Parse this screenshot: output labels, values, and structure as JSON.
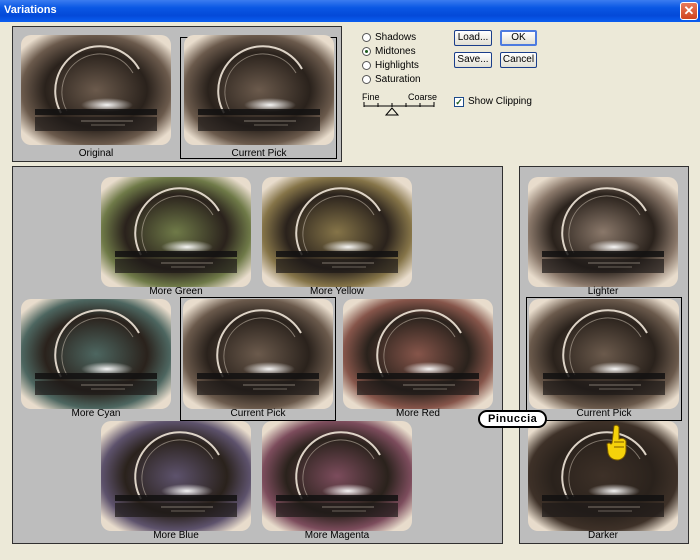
{
  "window": {
    "title": "Variations",
    "close_label": "✕"
  },
  "modes": [
    {
      "label": "Shadows",
      "selected": false
    },
    {
      "label": "Midtones",
      "selected": true
    },
    {
      "label": "Highlights",
      "selected": false
    },
    {
      "label": "Saturation",
      "selected": false
    }
  ],
  "buttons": {
    "load": "Load...",
    "ok": "OK",
    "save": "Save...",
    "cancel": "Cancel"
  },
  "slider": {
    "fine_label": "Fine",
    "coarse_label": "Coarse",
    "level": 0.4
  },
  "show_clipping": {
    "label": "Show Clipping",
    "checked": true
  },
  "top_preview": {
    "original": "Original",
    "current_pick": "Current Pick"
  },
  "color_grid": {
    "more_green": "More Green",
    "more_yellow": "More Yellow",
    "more_cyan": "More Cyan",
    "current_pick": "Current Pick",
    "more_red": "More Red",
    "more_blue": "More Blue",
    "more_magenta": "More Magenta"
  },
  "brightness": {
    "lighter": "Lighter",
    "current_pick": "Current Pick",
    "darker": "Darker"
  },
  "watermark": {
    "text": "Pinuccia"
  },
  "colors": {
    "panel": "#bdbdbd",
    "dialog": "#ece9d8",
    "titlebar": "#0a58e4",
    "tint_original": "#6b5a4c",
    "tint_green": "#6f7a48",
    "tint_yellow": "#857448",
    "tint_cyan": "#4d6660",
    "tint_red": "#86554a",
    "tint_blue": "#5d526c",
    "tint_magenta": "#7c4c5c",
    "tint_lighter": "#8a786a",
    "tint_darker": "#3e3128"
  }
}
